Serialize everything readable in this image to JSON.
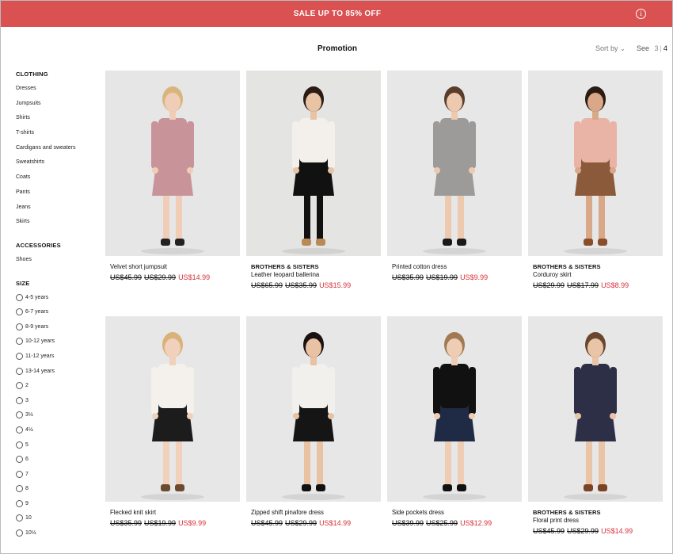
{
  "banner": {
    "text": "SALE UP TO 85% OFF",
    "info_icon": "info-icon"
  },
  "header": {
    "title": "Promotion",
    "sort_label": "Sort by",
    "see_label": "See",
    "see_options": [
      "3",
      "4"
    ]
  },
  "sidebar": {
    "clothing": {
      "heading": "CLOTHING",
      "items": [
        "Dresses",
        "Jumpsuits",
        "Shirts",
        "T-shirts",
        "Cardigans and sweaters",
        "Sweatshirts",
        "Coats",
        "Pants",
        "Jeans",
        "Skirts"
      ]
    },
    "accessories": {
      "heading": "ACCESSORIES",
      "items": [
        "Shoes"
      ]
    },
    "size": {
      "heading": "SIZE",
      "items": [
        "4-5 years",
        "6-7 years",
        "8-9 years",
        "10-12 years",
        "11-12 years",
        "13-14 years",
        "2",
        "3",
        "3½",
        "4½",
        "5",
        "6",
        "7",
        "8",
        "9",
        "10",
        "10½"
      ]
    }
  },
  "colors": {
    "banner": "#d95150",
    "sale_price": "#d7313a"
  },
  "products": [
    {
      "brand": "",
      "name": "Velvet short jumpsuit",
      "old1": "US$45.99",
      "old2": "US$29.99",
      "price": "US$14.99",
      "bg": "#e6e6e6",
      "skin": "#f0cdb6",
      "hair": "#d9b57e",
      "top": "#c9939a",
      "bottom": "#c9939a",
      "legs": "#f0cdb6",
      "shoes": "#222222"
    },
    {
      "brand": "BROTHERS & SISTERS",
      "name": "Leather leopard ballerina",
      "old1": "US$65.99",
      "old2": "US$35.99",
      "price": "US$15.99",
      "bg": "#e4e4e2",
      "skin": "#e8c3a4",
      "hair": "#2a1c14",
      "top": "#f3f0ec",
      "bottom": "#111111",
      "legs": "#111111",
      "shoes": "#b78a57"
    },
    {
      "brand": "",
      "name": "Printed cotton dress",
      "old1": "US$35.99",
      "old2": "US$19.99",
      "price": "US$9.99",
      "bg": "#e7e7e7",
      "skin": "#edc9b0",
      "hair": "#5a3e2b",
      "top": "#9d9b9a",
      "bottom": "#9d9b9a",
      "legs": "#edc9b0",
      "shoes": "#1a1a1a"
    },
    {
      "brand": "BROTHERS & SISTERS",
      "name": "Corduroy skirt",
      "old1": "US$29.99",
      "old2": "US$17.99",
      "price": "US$8.99",
      "bg": "#e7e7e7",
      "skin": "#d9a888",
      "hair": "#2b1b12",
      "top": "#e9b4a6",
      "bottom": "#8a5a3a",
      "legs": "#d9a888",
      "shoes": "#8a4e2c"
    },
    {
      "brand": "",
      "name": "Flecked knit skirt",
      "old1": "US$35.99",
      "old2": "US$19.99",
      "price": "US$9.99",
      "bg": "#e7e7e7",
      "skin": "#f1d1bc",
      "hair": "#d9b27a",
      "top": "#f4f1ec",
      "bottom": "#1c1c1c",
      "legs": "#f1d1bc",
      "shoes": "#6b4a30"
    },
    {
      "brand": "",
      "name": "Zipped shift pinafore dress",
      "old1": "US$45.99",
      "old2": "US$29.99",
      "price": "US$14.99",
      "bg": "#e7e7e7",
      "skin": "#e8c2a3",
      "hair": "#1a1210",
      "top": "#f2f0ec",
      "bottom": "#151515",
      "legs": "#e8c2a3",
      "shoes": "#111111"
    },
    {
      "brand": "",
      "name": "Side pockets dress",
      "old1": "US$39.99",
      "old2": "US$25.99",
      "price": "US$12.99",
      "bg": "#e7e7e7",
      "skin": "#efcdb5",
      "hair": "#a07a52",
      "top": "#111111",
      "bottom": "#1f2a44",
      "legs": "#efcdb5",
      "shoes": "#111111"
    },
    {
      "brand": "BROTHERS & SISTERS",
      "name": "Floral print dress",
      "old1": "US$45.99",
      "old2": "US$29.99",
      "price": "US$14.99",
      "bg": "#e7e7e7",
      "skin": "#eac4a6",
      "hair": "#6a4630",
      "top": "#2d2f46",
      "bottom": "#2d2f46",
      "legs": "#eac4a6",
      "shoes": "#7a4325"
    }
  ]
}
